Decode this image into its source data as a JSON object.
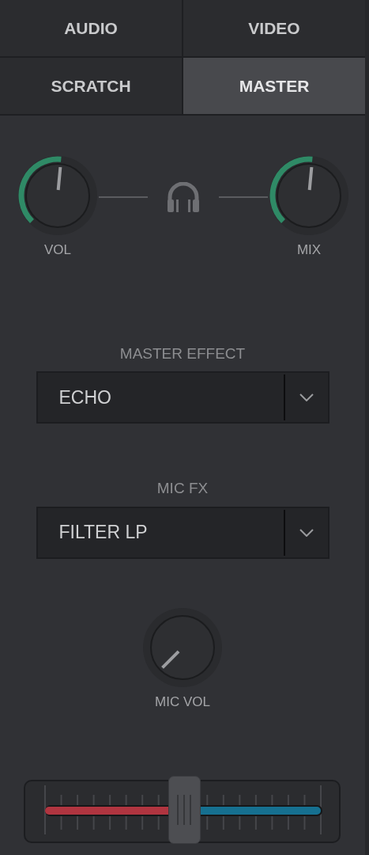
{
  "tabs": [
    {
      "label": "AUDIO",
      "selected": false
    },
    {
      "label": "VIDEO",
      "selected": false
    },
    {
      "label": "SCRATCH",
      "selected": false
    },
    {
      "label": "MASTER",
      "selected": true
    }
  ],
  "knobs": [
    {
      "label": "VOL"
    },
    {
      "label": "MIX"
    }
  ],
  "effects": [
    {
      "label": "MASTER EFFECT",
      "value": "ECHO"
    },
    {
      "label": "MIC FX",
      "value": "FILTER LP"
    }
  ],
  "mic_volume": {
    "label": "MIC VOL"
  },
  "crossfader": {
    "level": 0.5
  }
}
